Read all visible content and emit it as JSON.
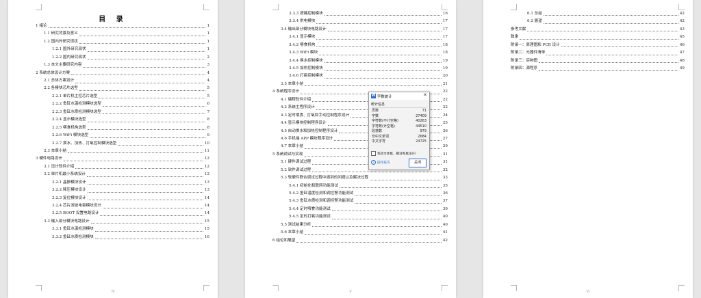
{
  "page1": {
    "title": "目  录",
    "footer": "IV",
    "entries": [
      {
        "text": "1 绪论",
        "page": "1",
        "level": 1
      },
      {
        "text": "1.1 研究背景及意义",
        "page": "1",
        "level": 2
      },
      {
        "text": "1.2 国内外研究现状",
        "page": "1",
        "level": 2
      },
      {
        "text": "1.2.1 国外研究现状",
        "page": "1",
        "level": 3
      },
      {
        "text": "1.2.2 国内研究现状",
        "page": "2",
        "level": 3
      },
      {
        "text": "1.3 本文主要研究内容",
        "page": "3",
        "level": 2
      },
      {
        "text": "2 系统总体设计方案",
        "page": "4",
        "level": 1
      },
      {
        "text": "2.1 总体方案设计",
        "page": "4",
        "level": 2
      },
      {
        "text": "2.2 各模块芯片选型",
        "page": "5",
        "level": 2
      },
      {
        "text": "2.2.1 单片机主控芯片选型",
        "page": "5",
        "level": 3
      },
      {
        "text": "2.2.2 鱼缸水温检测模块选型",
        "page": "6",
        "level": 3
      },
      {
        "text": "2.2.3 鱼缸水质检测模块选型",
        "page": "7",
        "level": 3
      },
      {
        "text": "2.2.4 显示模块选型",
        "page": "8",
        "level": 3
      },
      {
        "text": "2.2.5 喂食机构选型",
        "page": "8",
        "level": 3
      },
      {
        "text": "2.2.6 WiFi 模块选型",
        "page": "9",
        "level": 3
      },
      {
        "text": "2.2.7 换水、加热、打氧控制模块选型",
        "page": "10",
        "level": 3
      },
      {
        "text": "2.3 本章小结",
        "page": "11",
        "level": 2
      },
      {
        "text": "3 硬件电路设计",
        "page": "12",
        "level": 1
      },
      {
        "text": "3.1 设计软件介绍",
        "page": "12",
        "level": 2
      },
      {
        "text": "3.2 单片机最小系统设计",
        "page": "12",
        "level": 2
      },
      {
        "text": "3.2.1 晶振模块设计",
        "page": "13",
        "level": 3
      },
      {
        "text": "3.2.2 降压模块设计",
        "page": "13",
        "level": 3
      },
      {
        "text": "3.2.3 复位模块设计",
        "page": "14",
        "level": 3
      },
      {
        "text": "3.2.4 芯片滤波电容模块设计",
        "page": "14",
        "level": 3
      },
      {
        "text": "3.2.5 BOOT 设置电路设计",
        "page": "14",
        "level": 3
      },
      {
        "text": "3.3 输入部分模块电路设计",
        "page": "15",
        "level": 2
      },
      {
        "text": "3.3.1 鱼缸水温检测模块",
        "page": "15",
        "level": 3
      },
      {
        "text": "3.3.2 鱼缸水质检测模块",
        "page": "16",
        "level": 3
      }
    ]
  },
  "page2": {
    "footer": "V",
    "entries": [
      {
        "text": "3.3.3 按键控制模块",
        "page": "16",
        "level": 3
      },
      {
        "text": "3.3.4 供电模块",
        "page": "17",
        "level": 3
      },
      {
        "text": "3.4 输出部分模块电路设计",
        "page": "17",
        "level": 2
      },
      {
        "text": "3.4.1 显示模块",
        "page": "17",
        "level": 3
      },
      {
        "text": "3.4.2 喂食机构",
        "page": "18",
        "level": 3
      },
      {
        "text": "3.4.3 WiFi 模块",
        "page": "18",
        "level": 3
      },
      {
        "text": "3.4.4 换水控制模块",
        "page": "19",
        "level": 3
      },
      {
        "text": "3.4.5 加热控制模块",
        "page": "19",
        "level": 3
      },
      {
        "text": "3.4.6 打氧控制模块",
        "page": "20",
        "level": 3
      },
      {
        "text": "3.5 本章小结",
        "page": "21",
        "level": 2
      },
      {
        "text": "4 系统程序设计",
        "page": "22",
        "level": 1
      },
      {
        "text": "4.1 编程软件介绍",
        "page": "22",
        "level": 2
      },
      {
        "text": "4.2 系统主程序设计",
        "page": "22",
        "level": 2
      },
      {
        "text": "4.3 定时喂食、打氧和手动控制程序设计",
        "page": "24",
        "level": 2
      },
      {
        "text": "4.4 显示模块控制程序设计",
        "page": "25",
        "level": 2
      },
      {
        "text": "4.5 自动换水和加热控制程序设计",
        "page": "26",
        "level": 2
      },
      {
        "text": "4.6 手机端 APP 模块程序设计",
        "page": "27",
        "level": 2
      },
      {
        "text": "4.7 本章小结",
        "page": "29",
        "level": 2
      },
      {
        "text": "5 系统调试与实现",
        "page": "31",
        "level": 1
      },
      {
        "text": "5.1 硬件调试过程",
        "page": "31",
        "level": 2
      },
      {
        "text": "5.2 软件调试过程",
        "page": "32",
        "level": 2
      },
      {
        "text": "5.3 软硬件联合调试过程中遇到的问题以及解决过程",
        "page": "33",
        "level": 2
      },
      {
        "text": "5.4.1 初始化和联网功能测试",
        "page": "35",
        "level": 3
      },
      {
        "text": "5.4.2 鱼缸温度检测和调控警功能测试",
        "page": "36",
        "level": 3
      },
      {
        "text": "5.4.3 鱼缸水质检测和调控警功能测试",
        "page": "37",
        "level": 3
      },
      {
        "text": "5.4.4 定时喂食功能测试",
        "page": "39",
        "level": 3
      },
      {
        "text": "5.4.5 定时打氧功能测试",
        "page": "40",
        "level": 3
      },
      {
        "text": "5.5 测试结果分析",
        "page": "40",
        "level": 2
      },
      {
        "text": "5.6 本章小结",
        "page": "41",
        "level": 2
      },
      {
        "text": "6 结论和展望",
        "page": "42",
        "level": 1
      }
    ]
  },
  "page3": {
    "footer": "VI",
    "entries": [
      {
        "text": "6.1 总结",
        "page": "42",
        "level": 3
      },
      {
        "text": "6.2 展望",
        "page": "42",
        "level": 3
      },
      {
        "text": "参考文献",
        "page": "43",
        "level": 1
      },
      {
        "text": "致谢",
        "page": "45",
        "level": 1
      },
      {
        "text": "附录一：原理图和 PCB 设计",
        "page": "46",
        "level": 1
      },
      {
        "text": "附录二：元器件清单",
        "page": "47",
        "level": 1
      },
      {
        "text": "附录三：实物图",
        "page": "48",
        "level": 1
      },
      {
        "text": "附录四：源程序",
        "page": "49",
        "level": 1
      }
    ]
  },
  "dialog": {
    "icon_text": "W",
    "title": "字数统计",
    "close_glyph": "✕",
    "section": "统计信息",
    "stats": [
      {
        "label": "页数",
        "value": "71"
      },
      {
        "label": "字数",
        "value": "27409"
      },
      {
        "label": "字符数(不计空格)",
        "value": "40263"
      },
      {
        "label": "字符数(计空格)",
        "value": "44510"
      },
      {
        "label": "段落数",
        "value": "979"
      },
      {
        "label": "非中文单词",
        "value": "2684"
      },
      {
        "label": "中文字符",
        "value": "24725"
      }
    ],
    "checkbox_label": "包括文本框、脚注和尾注(F)",
    "checkbox_checked": false,
    "tips_label": "操作技巧",
    "close_button": "关闭"
  }
}
